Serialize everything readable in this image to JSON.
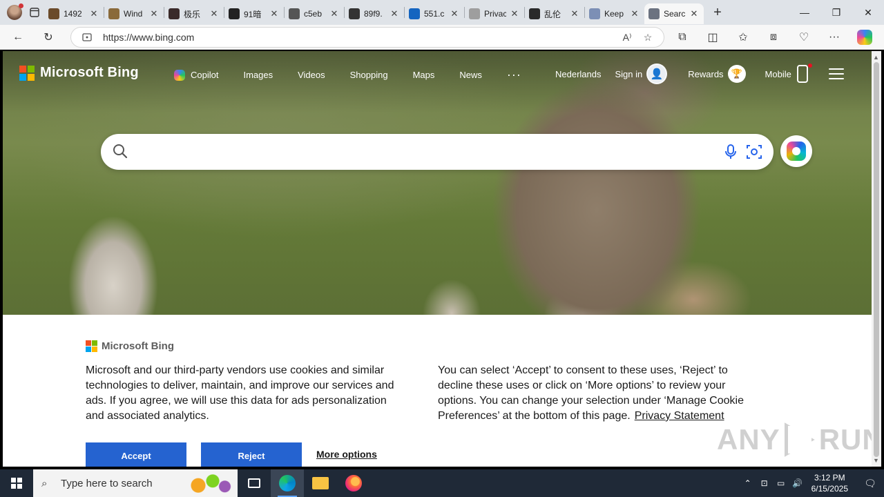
{
  "browser": {
    "tabs": [
      {
        "label": "1492",
        "favicon_color": "#6b4b2a"
      },
      {
        "label": "Wind",
        "favicon_color": "#8a6a3a"
      },
      {
        "label": "极乐",
        "favicon_color": "#3a2a2a"
      },
      {
        "label": "91暗",
        "favicon_color": "#222222"
      },
      {
        "label": "c5eb",
        "favicon_color": "#555555"
      },
      {
        "label": "89f9.",
        "favicon_color": "#333333"
      },
      {
        "label": "551.c",
        "favicon_color": "#1565c0"
      },
      {
        "label": "Privacy en",
        "favicon_color": "#9e9e9e"
      },
      {
        "label": "乱伦",
        "favicon_color": "#2a2a2a"
      },
      {
        "label": "Keep",
        "favicon_color": "#7c8fb5"
      },
      {
        "label": "Search",
        "favicon_color": "#6b7280",
        "active": true
      }
    ],
    "new_tab_icon": "plus-icon",
    "address": {
      "url": "https://www.bing.com"
    }
  },
  "bing": {
    "brand": "Microsoft Bing",
    "nav": {
      "copilot": "Copilot",
      "images": "Images",
      "videos": "Videos",
      "shopping": "Shopping",
      "maps": "Maps",
      "news": "News",
      "more": "···"
    },
    "language": "Nederlands",
    "sign_in": "Sign in",
    "rewards": "Rewards",
    "mobile": "Mobile",
    "search_placeholder": ""
  },
  "cookie": {
    "brand": "Microsoft Bing",
    "left_text": "Microsoft and our third-party vendors use cookies and similar technologies to deliver, maintain, and improve our services and ads. If you agree, we will use this data for ads personalization and associated analytics.",
    "right_text": "You can select ‘Accept’ to consent to these uses, ‘Reject’ to decline these uses or click on ‘More options’ to review your options. You can change your selection under ‘Manage Cookie Preferences’ at the bottom of this page.",
    "privacy_link": "Privacy Statement",
    "accept": "Accept",
    "reject": "Reject",
    "more_options": "More options",
    "accent_color": "#2563d0"
  },
  "watermark": {
    "left": "ANY",
    "right": "RUN"
  },
  "taskbar": {
    "search_placeholder": "Type here to search",
    "time": "3:12 PM",
    "date": "6/15/2025"
  }
}
